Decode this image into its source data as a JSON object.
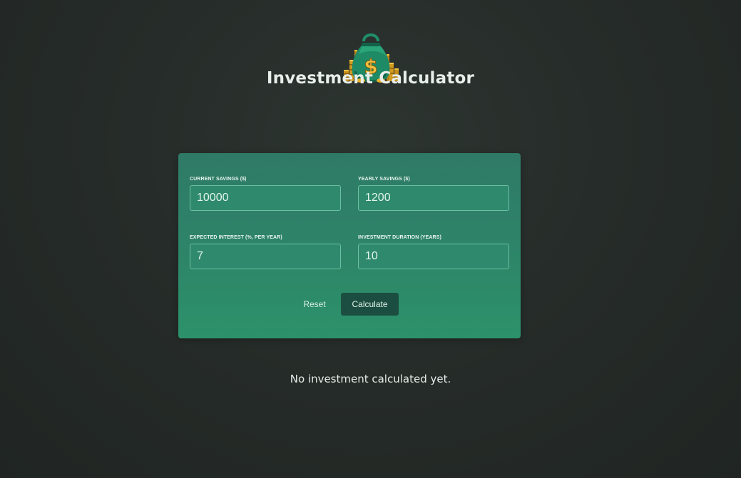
{
  "header": {
    "logo_icon": "money-bag-dollar-icon",
    "title": "Investment Calculator"
  },
  "form": {
    "current_savings": {
      "label": "Current Savings ($)",
      "value": "10000"
    },
    "yearly_savings": {
      "label": "Yearly Savings ($)",
      "value": "1200"
    },
    "expected_interest": {
      "label": "Expected Interest (%, per year)",
      "value": "7"
    },
    "investment_duration": {
      "label": "Investment Duration (years)",
      "value": "10"
    }
  },
  "actions": {
    "reset_label": "Reset",
    "calculate_label": "Calculate"
  },
  "status": {
    "message": "No investment calculated yet."
  },
  "colors": {
    "background": "#262c29",
    "card": "#2d8568",
    "calculate_button": "#1b4e40",
    "text": "#e6ece8"
  }
}
